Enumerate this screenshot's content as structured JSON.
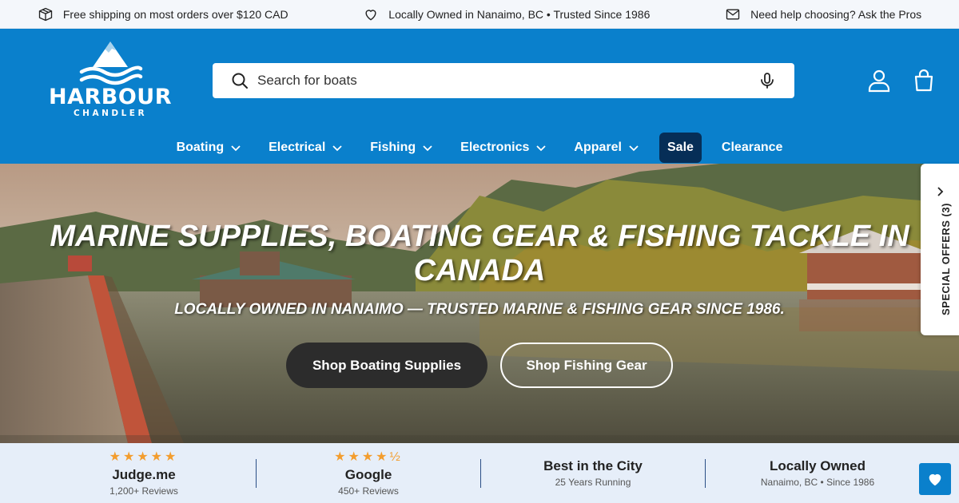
{
  "announcement": {
    "shipping": "Free shipping on most orders over $120 CAD",
    "local": "Locally Owned in Nanaimo, BC • Trusted Since 1986",
    "help": "Need help choosing? Ask the Pros",
    "icons": [
      "box-icon",
      "heart-icon",
      "mail-icon"
    ]
  },
  "logo": {
    "word": "HARBOUR",
    "sub": "CHANDLER"
  },
  "search": {
    "placeholder": "Search for boats"
  },
  "nav": {
    "items": [
      {
        "label": "Boating",
        "dropdown": true
      },
      {
        "label": "Electrical",
        "dropdown": true
      },
      {
        "label": "Fishing",
        "dropdown": true
      },
      {
        "label": "Electronics",
        "dropdown": true
      },
      {
        "label": "Apparel",
        "dropdown": true
      },
      {
        "label": "Sale",
        "dropdown": false
      },
      {
        "label": "Clearance",
        "dropdown": false
      }
    ]
  },
  "hero": {
    "title": "MARINE SUPPLIES, BOATING GEAR & FISHING TACKLE IN CANADA",
    "subtitle": "LOCALLY OWNED IN NANAIMO — TRUSTED MARINE & FISHING GEAR SINCE 1986.",
    "primary_cta": "Shop Boating Supplies",
    "secondary_cta": "Shop Fishing Gear"
  },
  "special_offers": {
    "label": "SPECIAL OFFERS (3)"
  },
  "reviews": [
    {
      "stars": "★★★★★",
      "title": "Judge.me",
      "sub": "1,200+ Reviews"
    },
    {
      "stars": "★★★★½",
      "title": "Google",
      "sub": "450+ Reviews"
    },
    {
      "stars": "",
      "title": "Best in the City",
      "sub": "25 Years Running"
    },
    {
      "stars": "",
      "title": "Locally Owned",
      "sub": "Nanaimo, BC • Since 1986"
    }
  ],
  "colors": {
    "brand_blue": "#0a80cc",
    "sale_bg": "#062e57",
    "star": "#f39d2e",
    "reviews_bg": "#e6eef9"
  }
}
